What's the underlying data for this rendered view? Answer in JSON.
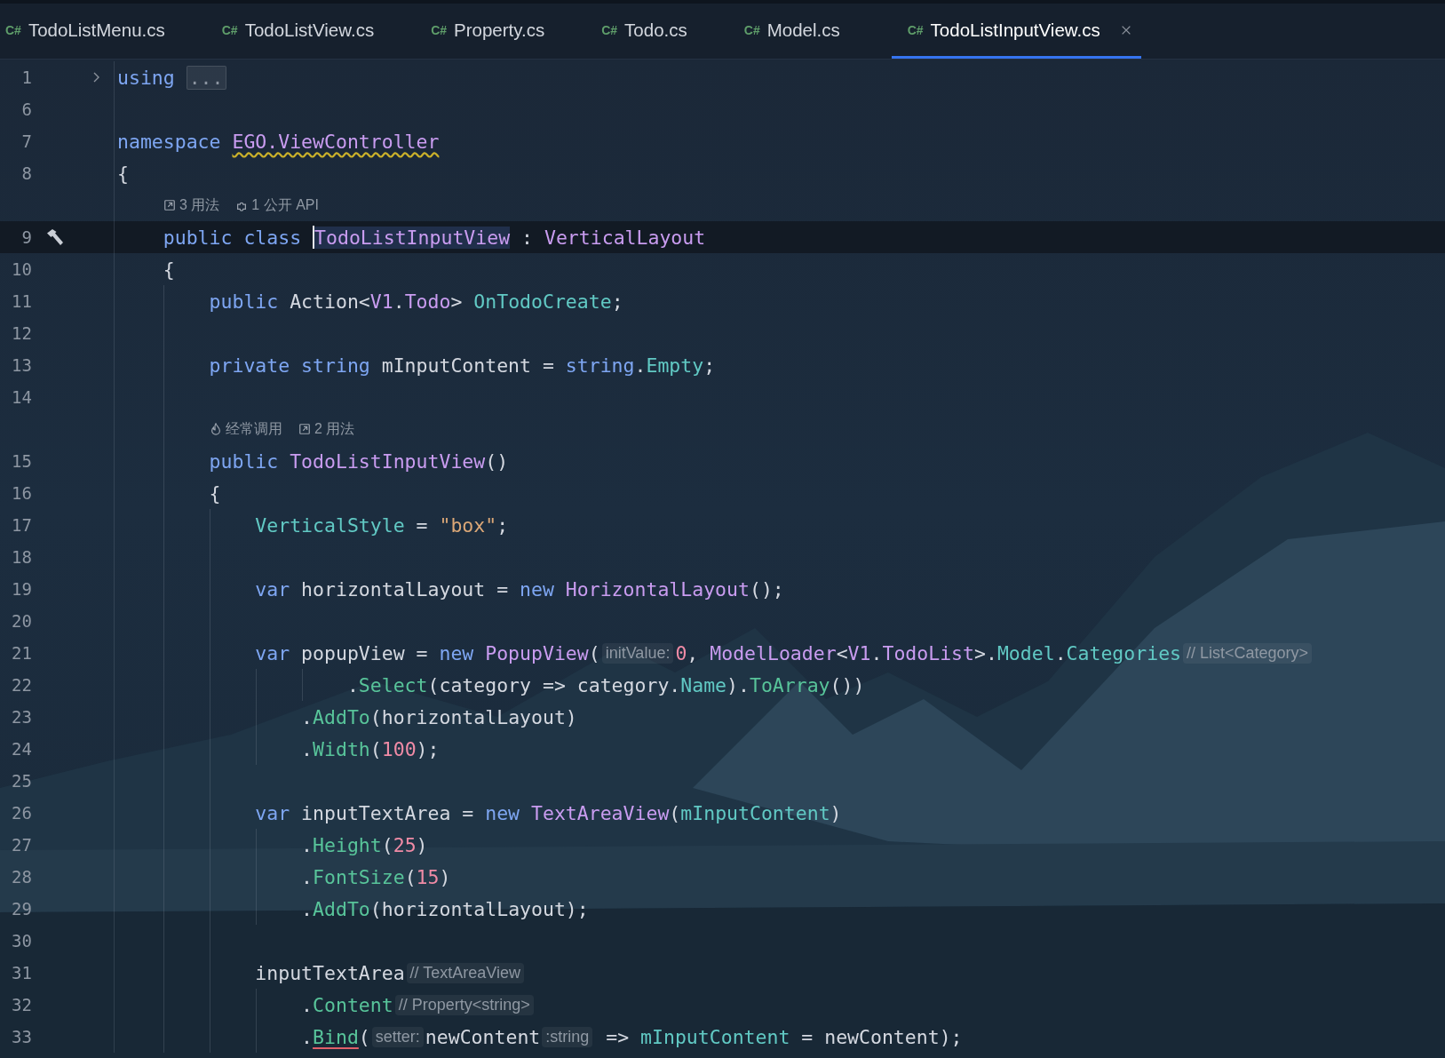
{
  "tabs": [
    {
      "icon_text": "C#",
      "label": "TodoListMenu.cs",
      "selected": false
    },
    {
      "icon_text": "C#",
      "label": "TodoListView.cs",
      "selected": false
    },
    {
      "icon_text": "C#",
      "label": "Property.cs",
      "selected": false
    },
    {
      "icon_text": "C#",
      "label": "Todo.cs",
      "selected": false
    },
    {
      "icon_text": "C#",
      "label": "Model.cs",
      "selected": false
    },
    {
      "icon_text": "C#",
      "label": "TodoListInputView.cs",
      "selected": true
    }
  ],
  "rows": [
    {
      "kind": "code",
      "number": "1",
      "current": false,
      "foldable": true,
      "gutter_marker": false,
      "tokens": [
        {
          "text": "using ",
          "kind": "keyword"
        },
        {
          "text": "...",
          "kind": "fold"
        }
      ]
    },
    {
      "kind": "code",
      "number": "6",
      "current": false,
      "foldable": false,
      "gutter_marker": false,
      "tokens": []
    },
    {
      "kind": "code",
      "number": "7",
      "current": false,
      "foldable": false,
      "gutter_marker": false,
      "tokens": [
        {
          "text": "namespace ",
          "kind": "keyword"
        },
        {
          "text": "EGO.ViewController",
          "kind": "type",
          "warning": true
        }
      ]
    },
    {
      "kind": "code",
      "number": "8",
      "current": false,
      "foldable": false,
      "gutter_marker": false,
      "tokens": [
        {
          "text": "{",
          "kind": "plain"
        }
      ]
    },
    {
      "kind": "lens",
      "items": [
        {
          "kind": "usages",
          "text": "3 用法"
        },
        {
          "kind": "api",
          "text": "1 公开 API"
        }
      ]
    },
    {
      "kind": "code",
      "number": "9",
      "current": true,
      "foldable": false,
      "gutter_marker": true,
      "tokens": [
        {
          "text": "    public class ",
          "kind": "keyword"
        },
        {
          "text": "TodoListInputView",
          "kind": "type",
          "caret": true,
          "highlighted": true
        },
        {
          "text": " : ",
          "kind": "plain"
        },
        {
          "text": "VerticalLayout",
          "kind": "type"
        }
      ]
    },
    {
      "kind": "code",
      "number": "10",
      "current": false,
      "foldable": false,
      "gutter_marker": false,
      "tokens": [
        {
          "text": "    {",
          "kind": "plain"
        }
      ]
    },
    {
      "kind": "code",
      "number": "11",
      "current": false,
      "foldable": false,
      "gutter_marker": false,
      "tokens": [
        {
          "text": "        public ",
          "kind": "keyword"
        },
        {
          "text": "Action<",
          "kind": "plain"
        },
        {
          "text": "V1",
          "kind": "type"
        },
        {
          "text": ".",
          "kind": "plain"
        },
        {
          "text": "Todo",
          "kind": "type"
        },
        {
          "text": "> ",
          "kind": "plain"
        },
        {
          "text": "OnTodoCreate",
          "kind": "field"
        },
        {
          "text": ";",
          "kind": "plain"
        }
      ]
    },
    {
      "kind": "code",
      "number": "12",
      "current": false,
      "foldable": false,
      "gutter_marker": false,
      "tokens": []
    },
    {
      "kind": "code",
      "number": "13",
      "current": false,
      "foldable": false,
      "gutter_marker": false,
      "tokens": [
        {
          "text": "        private string ",
          "kind": "keyword"
        },
        {
          "text": "mInputContent = ",
          "kind": "plain"
        },
        {
          "text": "string",
          "kind": "keyword"
        },
        {
          "text": ".",
          "kind": "plain"
        },
        {
          "text": "Empty",
          "kind": "field"
        },
        {
          "text": ";",
          "kind": "plain"
        }
      ]
    },
    {
      "kind": "code",
      "number": "14",
      "current": false,
      "foldable": false,
      "gutter_marker": false,
      "tokens": []
    },
    {
      "kind": "lens",
      "items": [
        {
          "kind": "hot",
          "text": "经常调用"
        },
        {
          "kind": "usages",
          "text": "2 用法"
        }
      ]
    },
    {
      "kind": "code",
      "number": "15",
      "current": false,
      "foldable": false,
      "gutter_marker": false,
      "tokens": [
        {
          "text": "        public ",
          "kind": "keyword"
        },
        {
          "text": "TodoListInputView",
          "kind": "type"
        },
        {
          "text": "()",
          "kind": "plain"
        }
      ]
    },
    {
      "kind": "code",
      "number": "16",
      "current": false,
      "foldable": false,
      "gutter_marker": false,
      "tokens": [
        {
          "text": "        {",
          "kind": "plain"
        }
      ]
    },
    {
      "kind": "code",
      "number": "17",
      "current": false,
      "foldable": false,
      "gutter_marker": false,
      "tokens": [
        {
          "text": "            VerticalStyle",
          "kind": "field"
        },
        {
          "text": " = ",
          "kind": "plain"
        },
        {
          "text": "\"box\"",
          "kind": "string"
        },
        {
          "text": ";",
          "kind": "plain"
        }
      ]
    },
    {
      "kind": "code",
      "number": "18",
      "current": false,
      "foldable": false,
      "gutter_marker": false,
      "tokens": []
    },
    {
      "kind": "code",
      "number": "19",
      "current": false,
      "foldable": false,
      "gutter_marker": false,
      "tokens": [
        {
          "text": "            var ",
          "kind": "keyword"
        },
        {
          "text": "horizontalLayout = ",
          "kind": "plain"
        },
        {
          "text": "new ",
          "kind": "keyword"
        },
        {
          "text": "HorizontalLayout",
          "kind": "type"
        },
        {
          "text": "();",
          "kind": "plain"
        }
      ]
    },
    {
      "kind": "code",
      "number": "20",
      "current": false,
      "foldable": false,
      "gutter_marker": false,
      "tokens": []
    },
    {
      "kind": "code",
      "number": "21",
      "current": false,
      "foldable": false,
      "gutter_marker": false,
      "tokens": [
        {
          "text": "            var ",
          "kind": "keyword"
        },
        {
          "text": "popupView = ",
          "kind": "plain"
        },
        {
          "text": "new ",
          "kind": "keyword"
        },
        {
          "text": "PopupView",
          "kind": "type"
        },
        {
          "text": "(",
          "kind": "plain"
        },
        {
          "text": "initValue:",
          "kind": "hint"
        },
        {
          "text": "0",
          "kind": "number"
        },
        {
          "text": ", ",
          "kind": "plain"
        },
        {
          "text": "ModelLoader",
          "kind": "type"
        },
        {
          "text": "<",
          "kind": "plain"
        },
        {
          "text": "V1",
          "kind": "type"
        },
        {
          "text": ".",
          "kind": "plain"
        },
        {
          "text": "TodoList",
          "kind": "type"
        },
        {
          "text": ">.",
          "kind": "plain"
        },
        {
          "text": "Model",
          "kind": "field"
        },
        {
          "text": ".",
          "kind": "plain"
        },
        {
          "text": "Categories",
          "kind": "field"
        },
        {
          "text": "// List<Category>",
          "kind": "hint"
        }
      ]
    },
    {
      "kind": "code",
      "number": "22",
      "current": false,
      "foldable": false,
      "gutter_marker": false,
      "tokens": [
        {
          "text": "                    .",
          "kind": "plain"
        },
        {
          "text": "Select",
          "kind": "method"
        },
        {
          "text": "(category => category.",
          "kind": "plain"
        },
        {
          "text": "Name",
          "kind": "field"
        },
        {
          "text": ").",
          "kind": "plain"
        },
        {
          "text": "ToArray",
          "kind": "method"
        },
        {
          "text": "())",
          "kind": "plain"
        }
      ]
    },
    {
      "kind": "code",
      "number": "23",
      "current": false,
      "foldable": false,
      "gutter_marker": false,
      "tokens": [
        {
          "text": "                .",
          "kind": "plain"
        },
        {
          "text": "AddTo",
          "kind": "method"
        },
        {
          "text": "(horizontalLayout)",
          "kind": "plain"
        }
      ]
    },
    {
      "kind": "code",
      "number": "24",
      "current": false,
      "foldable": false,
      "gutter_marker": false,
      "tokens": [
        {
          "text": "                .",
          "kind": "plain"
        },
        {
          "text": "Width",
          "kind": "method"
        },
        {
          "text": "(",
          "kind": "plain"
        },
        {
          "text": "100",
          "kind": "number"
        },
        {
          "text": ");",
          "kind": "plain"
        }
      ]
    },
    {
      "kind": "code",
      "number": "25",
      "current": false,
      "foldable": false,
      "gutter_marker": false,
      "tokens": []
    },
    {
      "kind": "code",
      "number": "26",
      "current": false,
      "foldable": false,
      "gutter_marker": false,
      "tokens": [
        {
          "text": "            var ",
          "kind": "keyword"
        },
        {
          "text": "inputTextArea = ",
          "kind": "plain"
        },
        {
          "text": "new ",
          "kind": "keyword"
        },
        {
          "text": "TextAreaView",
          "kind": "type"
        },
        {
          "text": "(",
          "kind": "plain"
        },
        {
          "text": "mInputContent",
          "kind": "field"
        },
        {
          "text": ")",
          "kind": "plain"
        }
      ]
    },
    {
      "kind": "code",
      "number": "27",
      "current": false,
      "foldable": false,
      "gutter_marker": false,
      "tokens": [
        {
          "text": "                .",
          "kind": "plain"
        },
        {
          "text": "Height",
          "kind": "method"
        },
        {
          "text": "(",
          "kind": "plain"
        },
        {
          "text": "25",
          "kind": "number"
        },
        {
          "text": ")",
          "kind": "plain"
        }
      ]
    },
    {
      "kind": "code",
      "number": "28",
      "current": false,
      "foldable": false,
      "gutter_marker": false,
      "tokens": [
        {
          "text": "                .",
          "kind": "plain"
        },
        {
          "text": "FontSize",
          "kind": "method"
        },
        {
          "text": "(",
          "kind": "plain"
        },
        {
          "text": "15",
          "kind": "number"
        },
        {
          "text": ")",
          "kind": "plain"
        }
      ]
    },
    {
      "kind": "code",
      "number": "29",
      "current": false,
      "foldable": false,
      "gutter_marker": false,
      "tokens": [
        {
          "text": "                .",
          "kind": "plain"
        },
        {
          "text": "AddTo",
          "kind": "method"
        },
        {
          "text": "(horizontalLayout);",
          "kind": "plain"
        }
      ]
    },
    {
      "kind": "code",
      "number": "30",
      "current": false,
      "foldable": false,
      "gutter_marker": false,
      "tokens": []
    },
    {
      "kind": "code",
      "number": "31",
      "current": false,
      "foldable": false,
      "gutter_marker": false,
      "tokens": [
        {
          "text": "            inputTextArea",
          "kind": "plain"
        },
        {
          "text": "// TextAreaView",
          "kind": "hint"
        }
      ]
    },
    {
      "kind": "code",
      "number": "32",
      "current": false,
      "foldable": false,
      "gutter_marker": false,
      "tokens": [
        {
          "text": "                .",
          "kind": "plain"
        },
        {
          "text": "Content",
          "kind": "method"
        },
        {
          "text": "// Property<string>",
          "kind": "hint"
        }
      ]
    },
    {
      "kind": "code",
      "number": "33",
      "current": false,
      "foldable": false,
      "gutter_marker": false,
      "tokens": [
        {
          "text": "                .",
          "kind": "plain"
        },
        {
          "text": "Bind",
          "kind": "method",
          "error": true
        },
        {
          "text": "(",
          "kind": "plain"
        },
        {
          "text": "setter:",
          "kind": "hint"
        },
        {
          "text": "newContent",
          "kind": "plain"
        },
        {
          "text": ":string",
          "kind": "hint"
        },
        {
          "text": " => ",
          "kind": "plain"
        },
        {
          "text": "mInputContent",
          "kind": "field"
        },
        {
          "text": " = newContent);",
          "kind": "plain"
        }
      ]
    }
  ]
}
